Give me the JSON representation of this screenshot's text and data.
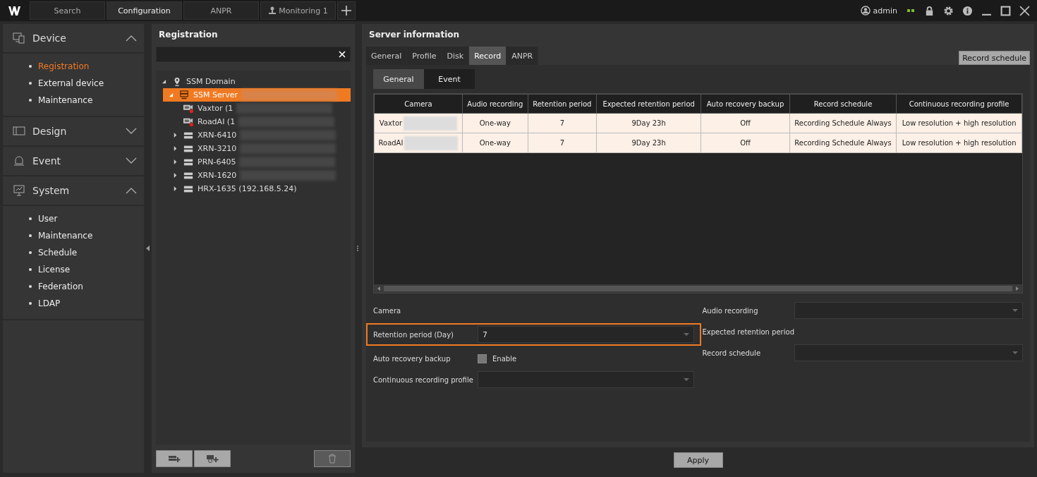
{
  "top_tabs": [
    {
      "label": "Search",
      "selected": false,
      "kind": "plain"
    },
    {
      "label": "Configuration",
      "selected": true,
      "kind": "plain"
    },
    {
      "label": "ANPR",
      "selected": false,
      "kind": "plain"
    },
    {
      "label": "Monitoring 1",
      "selected": false,
      "kind": "monitor"
    }
  ],
  "user": "admin",
  "sidebar": [
    {
      "label": "Device",
      "kind": "device",
      "expanded": true,
      "items": [
        {
          "label": "Registration",
          "selected": true
        },
        {
          "label": "External device",
          "selected": false
        },
        {
          "label": "Maintenance",
          "selected": false
        }
      ]
    },
    {
      "label": "Design",
      "kind": "design",
      "expanded": false
    },
    {
      "label": "Event",
      "kind": "event",
      "expanded": false
    },
    {
      "label": "System",
      "kind": "system",
      "expanded": true,
      "items": [
        {
          "label": "User",
          "selected": false
        },
        {
          "label": "Maintenance",
          "selected": false
        },
        {
          "label": "Schedule",
          "selected": false
        },
        {
          "label": "License",
          "selected": false
        },
        {
          "label": "Federation",
          "selected": false
        },
        {
          "label": "LDAP",
          "selected": false
        }
      ]
    }
  ],
  "registration": {
    "title": "Registration",
    "tree": [
      {
        "label": "SSM Domain",
        "kind": "domain",
        "expanded": true,
        "selected": false,
        "children": [
          {
            "label": "SSM Server",
            "kind": "server",
            "expanded": true,
            "selected": true,
            "blurred": true,
            "children": [
              {
                "label": "Vaxtor (1",
                "kind": "camera",
                "selected": false,
                "blurred": true
              },
              {
                "label": "RoadAI (1",
                "kind": "camera",
                "selected": false,
                "blurred": true
              },
              {
                "label": "XRN-6410",
                "kind": "recorder",
                "expanded": false,
                "selected": false,
                "blurred": true
              },
              {
                "label": "XRN-3210",
                "kind": "recorder",
                "expanded": false,
                "selected": false,
                "blurred": true
              },
              {
                "label": "PRN-6405",
                "kind": "recorder",
                "expanded": false,
                "selected": false,
                "blurred": true
              },
              {
                "label": "XRN-1620",
                "kind": "recorder",
                "expanded": false,
                "selected": false,
                "blurred": true
              },
              {
                "label": "HRX-1635 (192.168.5.24)",
                "kind": "recorder",
                "expanded": false,
                "selected": false
              }
            ]
          }
        ]
      }
    ]
  },
  "server": {
    "title": "Server information",
    "tabs": [
      {
        "label": "General",
        "selected": false
      },
      {
        "label": "Profile",
        "selected": false
      },
      {
        "label": "Disk",
        "selected": false
      },
      {
        "label": "Record",
        "selected": true
      },
      {
        "label": "ANPR",
        "selected": false
      }
    ],
    "record_schedule_button": "Record schedule",
    "sub_tabs": [
      {
        "label": "General",
        "selected": true
      },
      {
        "label": "Event",
        "selected": false
      }
    ],
    "table": {
      "columns": [
        "Camera",
        "Audio recording",
        "Retention period",
        "Expected retention period",
        "Auto recovery backup",
        "Record schedule",
        "Continuous recording profile"
      ],
      "rows": [
        [
          "Vaxtor",
          "One-way",
          "7",
          "9Day 23h",
          "Off",
          "Recording Schedule Always",
          "Low resolution + high resolution"
        ],
        [
          "RoadAI",
          "One-way",
          "7",
          "9Day 23h",
          "Off",
          "Recording Schedule Always",
          "Low resolution + high resolution"
        ]
      ]
    },
    "form": {
      "camera_label": "Camera",
      "retention_label": "Retention period  (Day)",
      "retention_value": "7",
      "retention_highlighted": true,
      "backup_label": "Auto recovery backup",
      "backup_checkbox": {
        "label": "Enable",
        "checked": false
      },
      "profile_label": "Continuous recording profile",
      "audio_label": "Audio recording",
      "expected_label": "Expected retention period",
      "schedule_label": "Record schedule"
    },
    "apply_button": "Apply"
  }
}
